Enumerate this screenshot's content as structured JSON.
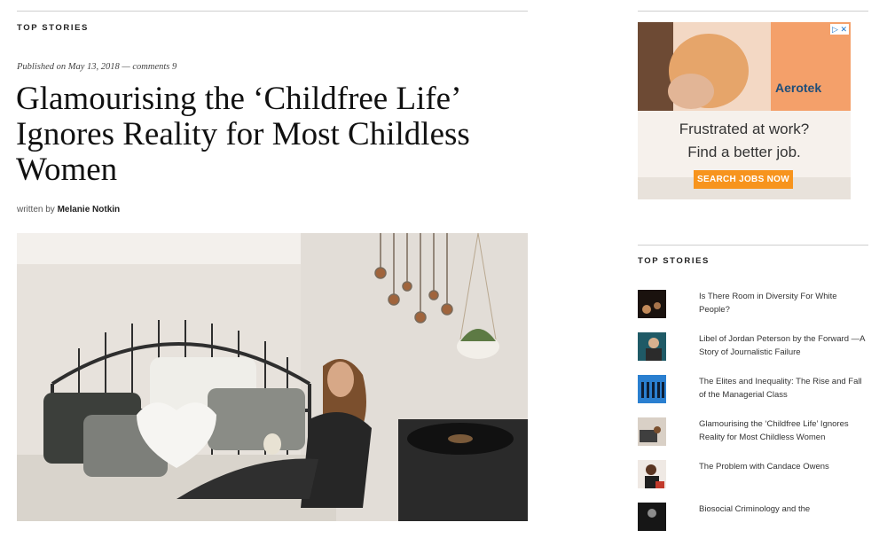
{
  "main": {
    "section_label": "TOP STORIES",
    "meta": {
      "published_prefix": "Published on",
      "date": "May 13, 2018",
      "separator": "—",
      "comments": "comments 9"
    },
    "title": "Glamourising the ‘Childfree Life’ Ignores Reality for Most Childless Women",
    "byline": {
      "prefix": "written by",
      "author": "Melanie Notkin"
    }
  },
  "ad": {
    "brand": "Aerotek",
    "line1": "Frustrated at work?",
    "line2": "Find a better job.",
    "cta": "SEARCH JOBS NOW",
    "adchoices_icon": "adchoices-icon",
    "close_icon": "close-icon"
  },
  "sidebar": {
    "section_label": "TOP STORIES",
    "stories": [
      {
        "title": "Is There Room in Diversity For White People?"
      },
      {
        "title": "Libel of Jordan Peterson by the Forward —A Story of Journalistic Failure"
      },
      {
        "title": "The Elites and Inequality: The Rise and Fall of the Managerial Class"
      },
      {
        "title": "Glamourising the ‘Childfree Life’ Ignores Reality for Most Childless Women"
      },
      {
        "title": "The Problem with Candace Owens"
      },
      {
        "title": "Biosocial Criminology and the"
      }
    ]
  },
  "colors": {
    "cta": "#f7941d",
    "brand": "#1f4e79",
    "rule": "#cfcfcf"
  }
}
